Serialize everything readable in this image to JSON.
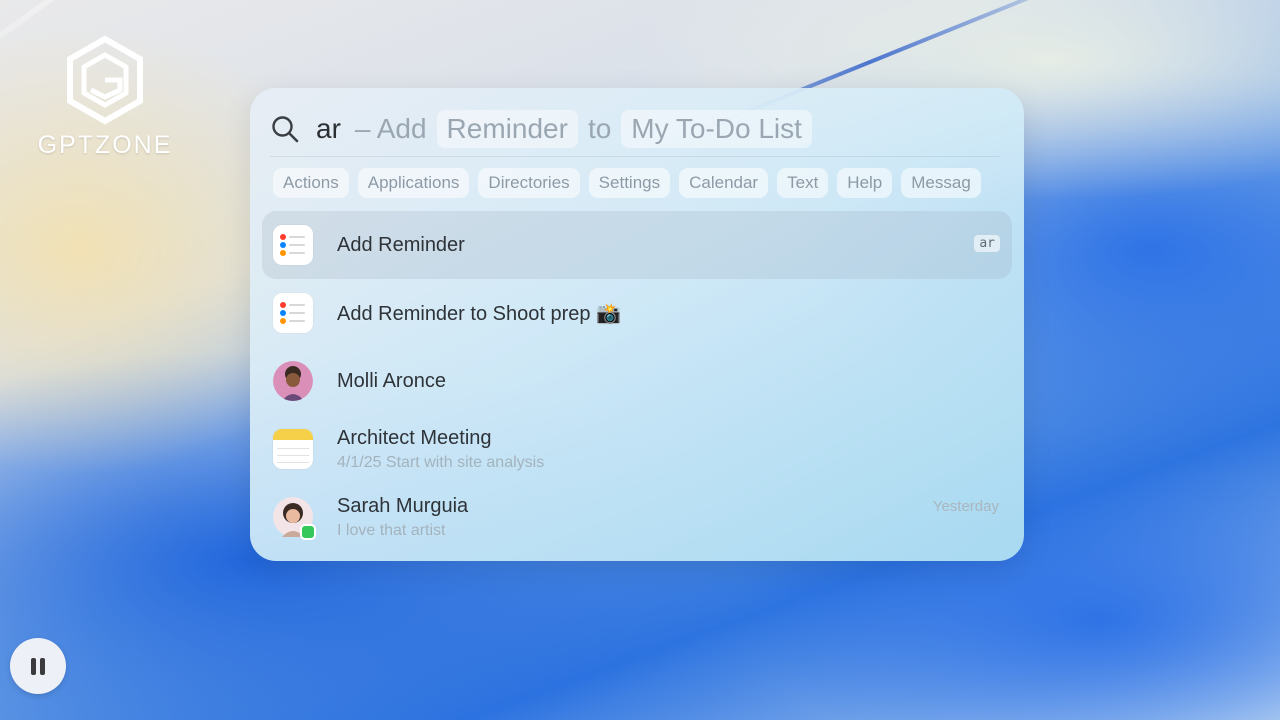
{
  "logo": {
    "text": "GPTZONE"
  },
  "search": {
    "query": "ar",
    "hint_dash": "– Add",
    "hint_action": "Reminder",
    "hint_to": "to",
    "hint_target": "My To-Do List"
  },
  "filters": [
    "Actions",
    "Applications",
    "Directories",
    "Settings",
    "Calendar",
    "Text",
    "Help",
    "Messag"
  ],
  "results": [
    {
      "title": "Add Reminder",
      "badge": "ar",
      "icon": "reminders-app-icon",
      "selected": true
    },
    {
      "title": "Add Reminder to Shoot prep 📸",
      "icon": "reminders-app-icon"
    },
    {
      "title": "Molli Aronce",
      "icon": "contact-avatar"
    },
    {
      "title": "Architect Meeting",
      "subtitle": "4/1/25 Start with site analysis",
      "icon": "notes-app-icon"
    },
    {
      "title": "Sarah Murguia",
      "subtitle": "I love that artist",
      "time": "Yesterday",
      "icon": "messages-avatar"
    }
  ],
  "colors": {
    "accent_reminder_dots": [
      "#ff3b30",
      "#0a84ff",
      "#ff9500"
    ],
    "notes_yellow": "#f7d04a",
    "messages_green": "#34c759"
  }
}
